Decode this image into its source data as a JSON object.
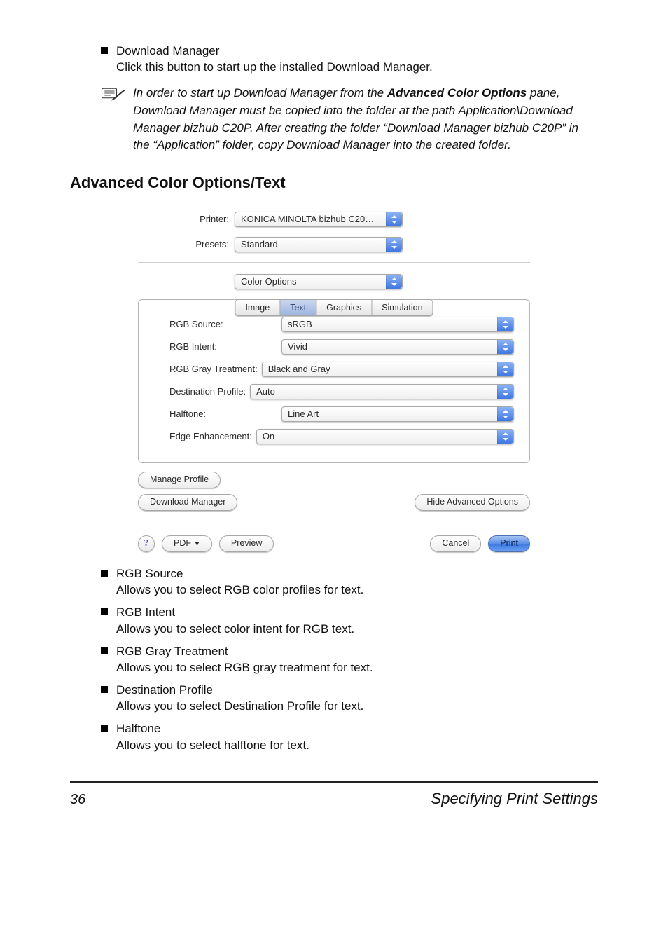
{
  "top_bullets": {
    "dm_title": "Download Manager",
    "dm_desc": "Click this button to start up the installed Download Manager."
  },
  "note": {
    "segments": [
      {
        "t": "In order to start up Download Manager from the ",
        "b": false
      },
      {
        "t": "Advanced Color Options",
        "b": true
      },
      {
        "t": " pane, Download Manager must be copied into the folder at the path Application\\Download Manager bizhub C20P. After creating the folder “Download Manager bizhub C20P” in the “Application” folder, copy Download Manager into the created folder.",
        "b": false
      }
    ]
  },
  "section_heading": "Advanced Color Options/Text",
  "dialog": {
    "printer_label": "Printer:",
    "printer_value": "KONICA MINOLTA bizhub C20…",
    "presets_label": "Presets:",
    "presets_value": "Standard",
    "pane_value": "Color Options",
    "tabs": [
      "Image",
      "Text",
      "Graphics",
      "Simulation"
    ],
    "selected_tab": "Text",
    "options": [
      {
        "label": "RGB Source:",
        "value": "sRGB",
        "mode": "split"
      },
      {
        "label": "RGB Intent:",
        "value": "Vivid",
        "mode": "split"
      },
      {
        "label": "RGB Gray Treatment:",
        "value": "Black and Gray",
        "mode": "inline"
      },
      {
        "label": "Destination Profile:",
        "value": "Auto",
        "mode": "inline"
      },
      {
        "label": "Halftone:",
        "value": "Line Art",
        "mode": "split"
      },
      {
        "label": "Edge Enhancement:",
        "value": "On",
        "mode": "inline"
      }
    ],
    "manage_profile": "Manage Profile",
    "download_manager": "Download Manager",
    "hide_advanced": "Hide Advanced Options",
    "help": "?",
    "pdf": "PDF",
    "preview": "Preview",
    "cancel": "Cancel",
    "print": "Print"
  },
  "explain_bullets": [
    {
      "title": "RGB Source",
      "desc": "Allows you to select RGB color profiles for text."
    },
    {
      "title": "RGB Intent",
      "desc": "Allows you to select color intent for RGB text."
    },
    {
      "title": "RGB Gray Treatment",
      "desc": "Allows you to select RGB gray treatment for text."
    },
    {
      "title": "Destination Profile",
      "desc": "Allows you to select Destination Profile for text."
    },
    {
      "title": "Halftone",
      "desc": "Allows you to select halftone for text."
    }
  ],
  "footer": {
    "page_no": "36",
    "section": "Specifying Print Settings"
  }
}
